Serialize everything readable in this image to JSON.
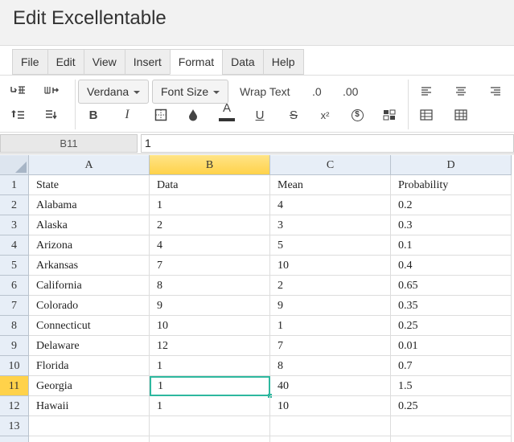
{
  "app": {
    "title": "Edit Excellentable"
  },
  "menu": [
    "File",
    "Edit",
    "View",
    "Insert",
    "Format",
    "Data",
    "Help"
  ],
  "active_menu": "Format",
  "toolbar": {
    "font_family": "Verdana",
    "font_size": "Font Size",
    "wrap_text": "Wrap Text",
    "decrease_decimal": ".0",
    "increase_decimal": ".00",
    "bold": "B",
    "italic": "I",
    "text_color": "A",
    "underline": "U",
    "strikethrough": "S",
    "superscript": "x²",
    "currency": "$",
    "icons": [
      "insert-row-above-icon",
      "insert-column-icon",
      "insert-row-below-icon",
      "delete-row-icon",
      "border-icon",
      "fill-color-icon",
      "conditional-format-icon",
      "align-left-icon",
      "align-center-icon",
      "align-right-icon",
      "table-icon",
      "grid-icon"
    ],
    "text_color_hex": "#333333",
    "selection_color": "#2eb89f"
  },
  "formula_bar": {
    "name_box": "B11",
    "value": "1"
  },
  "sheet": {
    "columns": [
      "A",
      "B",
      "C",
      "D"
    ],
    "selected_column": "B",
    "selected_row": "11",
    "rows": [
      {
        "num": "1",
        "cells": [
          "State",
          "Data",
          "Mean",
          "Probability"
        ]
      },
      {
        "num": "2",
        "cells": [
          "Alabama",
          "1",
          "4",
          "0.2"
        ]
      },
      {
        "num": "3",
        "cells": [
          "Alaska",
          "2",
          "3",
          "0.3"
        ]
      },
      {
        "num": "4",
        "cells": [
          "Arizona",
          "4",
          "5",
          "0.1"
        ]
      },
      {
        "num": "5",
        "cells": [
          "Arkansas",
          "7",
          "10",
          "0.4"
        ]
      },
      {
        "num": "6",
        "cells": [
          "California",
          "8",
          "2",
          "0.65"
        ]
      },
      {
        "num": "7",
        "cells": [
          "Colorado",
          "9",
          "9",
          "0.35"
        ]
      },
      {
        "num": "8",
        "cells": [
          "Connecticut",
          "10",
          "1",
          "0.25"
        ]
      },
      {
        "num": "9",
        "cells": [
          "Delaware",
          "12",
          "7",
          "0.01"
        ]
      },
      {
        "num": "10",
        "cells": [
          "Florida",
          "1",
          "8",
          "0.7"
        ]
      },
      {
        "num": "11",
        "cells": [
          "Georgia",
          "1",
          "40",
          "1.5"
        ]
      },
      {
        "num": "12",
        "cells": [
          "Hawaii",
          "1",
          "10",
          "0.25"
        ]
      },
      {
        "num": "13",
        "cells": [
          "",
          "",
          "",
          ""
        ]
      },
      {
        "num": "",
        "cells": [
          "",
          "",
          "",
          ""
        ]
      }
    ]
  }
}
